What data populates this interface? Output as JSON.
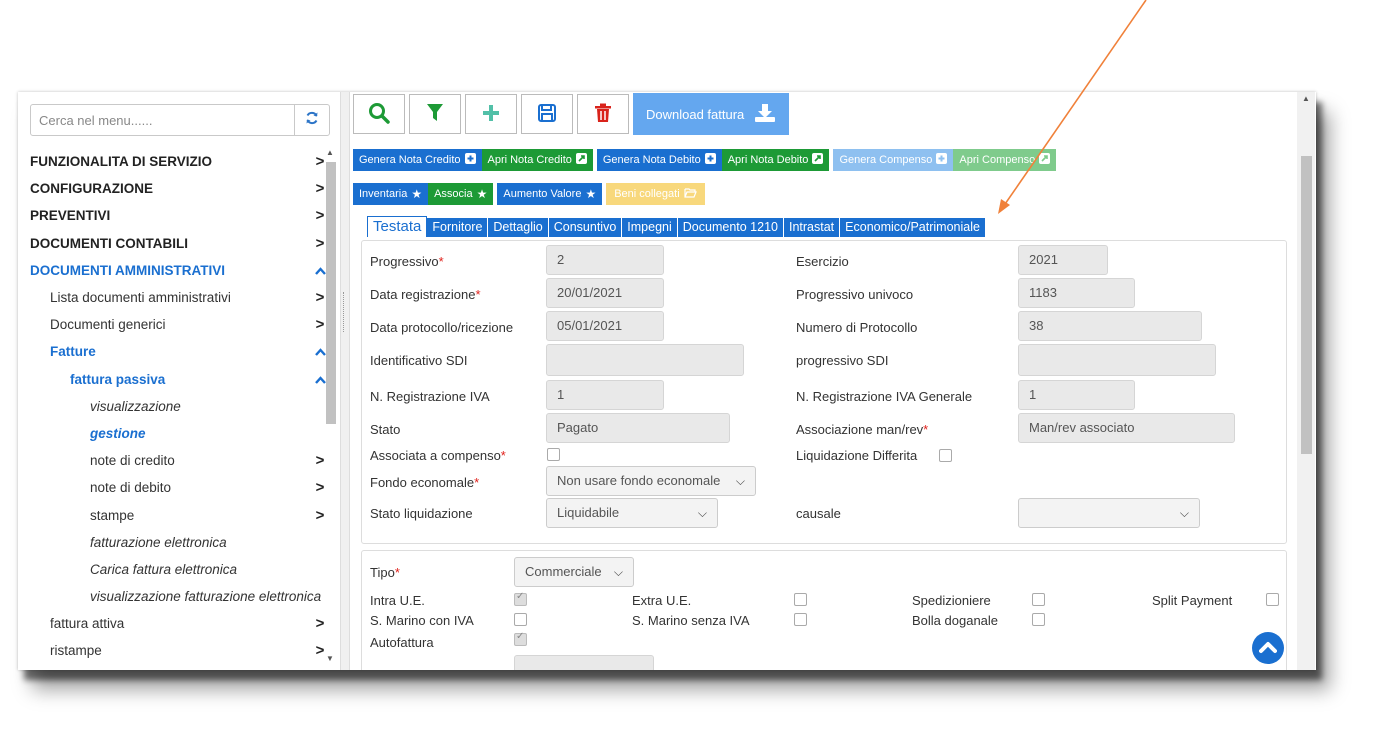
{
  "sidebar": {
    "search_placeholder": "Cerca nel menu......",
    "items": [
      {
        "label": "FUNZIONALITA DI SERVIZIO",
        "chev": ">"
      },
      {
        "label": "CONFIGURAZIONE",
        "chev": ">"
      },
      {
        "label": "PREVENTIVI",
        "chev": ">"
      },
      {
        "label": "DOCUMENTI CONTABILI",
        "chev": ">"
      },
      {
        "label": "DOCUMENTI AMMINISTRATIVI",
        "chev": "^"
      },
      {
        "label": "Lista documenti amministrativi",
        "chev": ">"
      },
      {
        "label": "Documenti generici",
        "chev": ">"
      },
      {
        "label": "Fatture",
        "chev": "^"
      },
      {
        "label": "fattura passiva",
        "chev": "^"
      },
      {
        "label": "visualizzazione",
        "chev": ""
      },
      {
        "label": "gestione",
        "chev": ""
      },
      {
        "label": "note di credito",
        "chev": ">"
      },
      {
        "label": "note di debito",
        "chev": ">"
      },
      {
        "label": "stampe",
        "chev": ">"
      },
      {
        "label": "fatturazione elettronica",
        "chev": ""
      },
      {
        "label": "Carica fattura elettronica",
        "chev": ""
      },
      {
        "label": "visualizzazione fatturazione elettronica",
        "chev": ""
      },
      {
        "label": "fattura attiva",
        "chev": ">"
      },
      {
        "label": "ristampe",
        "chev": ">"
      }
    ]
  },
  "toolbar": {
    "download_label": "Download fattura"
  },
  "buttons": {
    "genera_nota_credito": "Genera Nota Credito",
    "apri_nota_credito": "Apri Nota Credito",
    "genera_nota_debito": "Genera Nota Debito",
    "apri_nota_debito": "Apri Nota Debito",
    "genera_compenso": "Genera Compenso",
    "apri_compenso": "Apri Compenso",
    "inventaria": "Inventaria",
    "associa": "Associa",
    "aumento_valore": "Aumento Valore",
    "beni_collegati": "Beni collegati"
  },
  "tabs": [
    "Testata",
    "Fornitore",
    "Dettaglio",
    "Consuntivo",
    "Impegni",
    "Documento 1210",
    "Intrastat",
    "Economico/Patrimoniale"
  ],
  "form": {
    "progressivo_label": "Progressivo",
    "progressivo_value": "2",
    "esercizio_label": "Esercizio",
    "esercizio_value": "2021",
    "data_registrazione_label": "Data registrazione",
    "data_registrazione_value": "20/01/2021",
    "progressivo_univoco_label": "Progressivo univoco",
    "progressivo_univoco_value": "1183",
    "data_protocollo_label": "Data protocollo/ricezione",
    "data_protocollo_value": "05/01/2021",
    "numero_protocollo_label": "Numero di Protocollo",
    "numero_protocollo_value": "38",
    "identificativo_sdi_label": "Identificativo SDI",
    "identificativo_sdi_value": "",
    "progressivo_sdi_label": "progressivo SDI",
    "progressivo_sdi_value": "",
    "n_reg_iva_label": "N. Registrazione IVA",
    "n_reg_iva_value": "1",
    "n_reg_iva_generale_label": "N. Registrazione IVA Generale",
    "n_reg_iva_generale_value": "1",
    "stato_label": "Stato",
    "stato_value": "Pagato",
    "associazione_label": "Associazione man/rev",
    "associazione_value": "Man/rev associato",
    "associata_compenso_label": "Associata a compenso",
    "liquidazione_differita_label": "Liquidazione Differita",
    "fondo_economale_label": "Fondo economale",
    "fondo_economale_value": "Non usare fondo economale",
    "stato_liquidazione_label": "Stato liquidazione",
    "stato_liquidazione_value": "Liquidabile",
    "causale_label": "causale",
    "causale_value": ""
  },
  "form2": {
    "tipo_label": "Tipo",
    "tipo_value": "Commerciale",
    "intra_ue_label": "Intra U.E.",
    "extra_ue_label": "Extra U.E.",
    "spedizioniere_label": "Spedizioniere",
    "split_payment_label": "Split Payment",
    "s_marino_con_iva_label": "S. Marino con IVA",
    "s_marino_senza_iva_label": "S. Marino senza IVA",
    "bolla_doganale_label": "Bolla doganale",
    "autofattura_label": "Autofattura"
  },
  "colors": {
    "primary": "#1a6fd0",
    "success": "#1d9a36",
    "danger": "#d9231b",
    "annotation_arrow": "#f0813a"
  }
}
